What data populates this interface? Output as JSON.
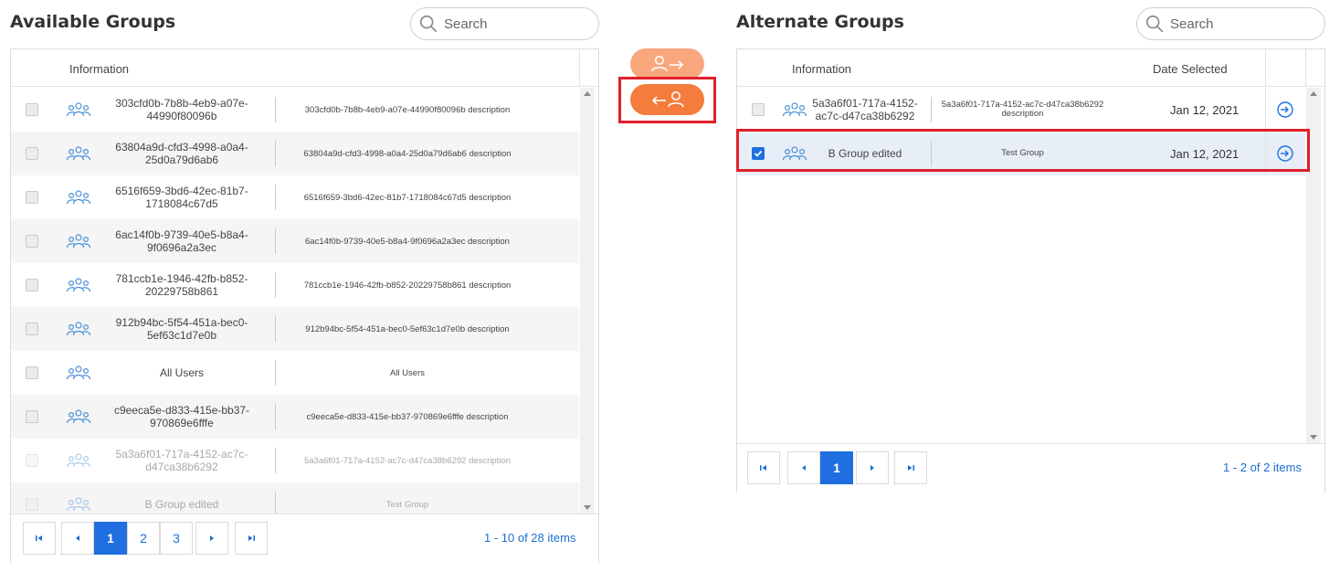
{
  "available": {
    "title": "Available Groups",
    "search_placeholder": "Search",
    "column_information": "Information",
    "rows": [
      {
        "name": "303cfd0b-7b8b-4eb9-a07e-44990f80096b",
        "description": "303cfd0b-7b8b-4eb9-a07e-44990f80096b description",
        "disabled": false
      },
      {
        "name": "63804a9d-cfd3-4998-a0a4-25d0a79d6ab6",
        "description": "63804a9d-cfd3-4998-a0a4-25d0a79d6ab6 description",
        "disabled": false
      },
      {
        "name": "6516f659-3bd6-42ec-81b7-1718084c67d5",
        "description": "6516f659-3bd6-42ec-81b7-1718084c67d5 description",
        "disabled": false
      },
      {
        "name": "6ac14f0b-9739-40e5-b8a4-9f0696a2a3ec",
        "description": "6ac14f0b-9739-40e5-b8a4-9f0696a2a3ec description",
        "disabled": false
      },
      {
        "name": "781ccb1e-1946-42fb-b852-20229758b861",
        "description": "781ccb1e-1946-42fb-b852-20229758b861 description",
        "disabled": false
      },
      {
        "name": "912b94bc-5f54-451a-bec0-5ef63c1d7e0b",
        "description": "912b94bc-5f54-451a-bec0-5ef63c1d7e0b description",
        "disabled": false
      },
      {
        "name": "All Users",
        "description": "All Users",
        "disabled": false
      },
      {
        "name": "c9eeca5e-d833-415e-bb37-970869e6fffe",
        "description": "c9eeca5e-d833-415e-bb37-970869e6fffe description",
        "disabled": false
      },
      {
        "name": "5a3a6f01-717a-4152-ac7c-d47ca38b6292",
        "description": "5a3a6f01-717a-4152-ac7c-d47ca38b6292 description",
        "disabled": true
      },
      {
        "name": "B Group edited",
        "description": "Test Group",
        "disabled": true
      }
    ],
    "pager": {
      "pages": [
        "1",
        "2",
        "3"
      ],
      "current": "1",
      "info": "1 - 10 of 28 items"
    }
  },
  "alternate": {
    "title": "Alternate Groups",
    "search_placeholder": "Search",
    "column_information": "Information",
    "column_date": "Date Selected",
    "rows": [
      {
        "name": "5a3a6f01-717a-4152-ac7c-d47ca38b6292",
        "description": "5a3a6f01-717a-4152-ac7c-d47ca38b6292 description",
        "date": "Jan 12, 2021",
        "checked": false
      },
      {
        "name": "B Group edited",
        "description": "Test Group",
        "date": "Jan 12, 2021",
        "checked": true
      }
    ],
    "pager": {
      "pages": [
        "1"
      ],
      "current": "1",
      "info": "1 - 2 of 2 items"
    }
  },
  "icons": {
    "search": "search-icon",
    "group": "group-icon",
    "add_to_alternate": "user-arrow-right-icon",
    "remove_from_alternate": "arrow-left-user-icon",
    "go": "enter-arrow-icon"
  },
  "colors": {
    "move_right_button": "#f9a77d",
    "move_left_button": "#f57c3c",
    "highlight_box": "#e0202a",
    "accent": "#1f6fe0",
    "selected_row": "#e8eef8"
  }
}
